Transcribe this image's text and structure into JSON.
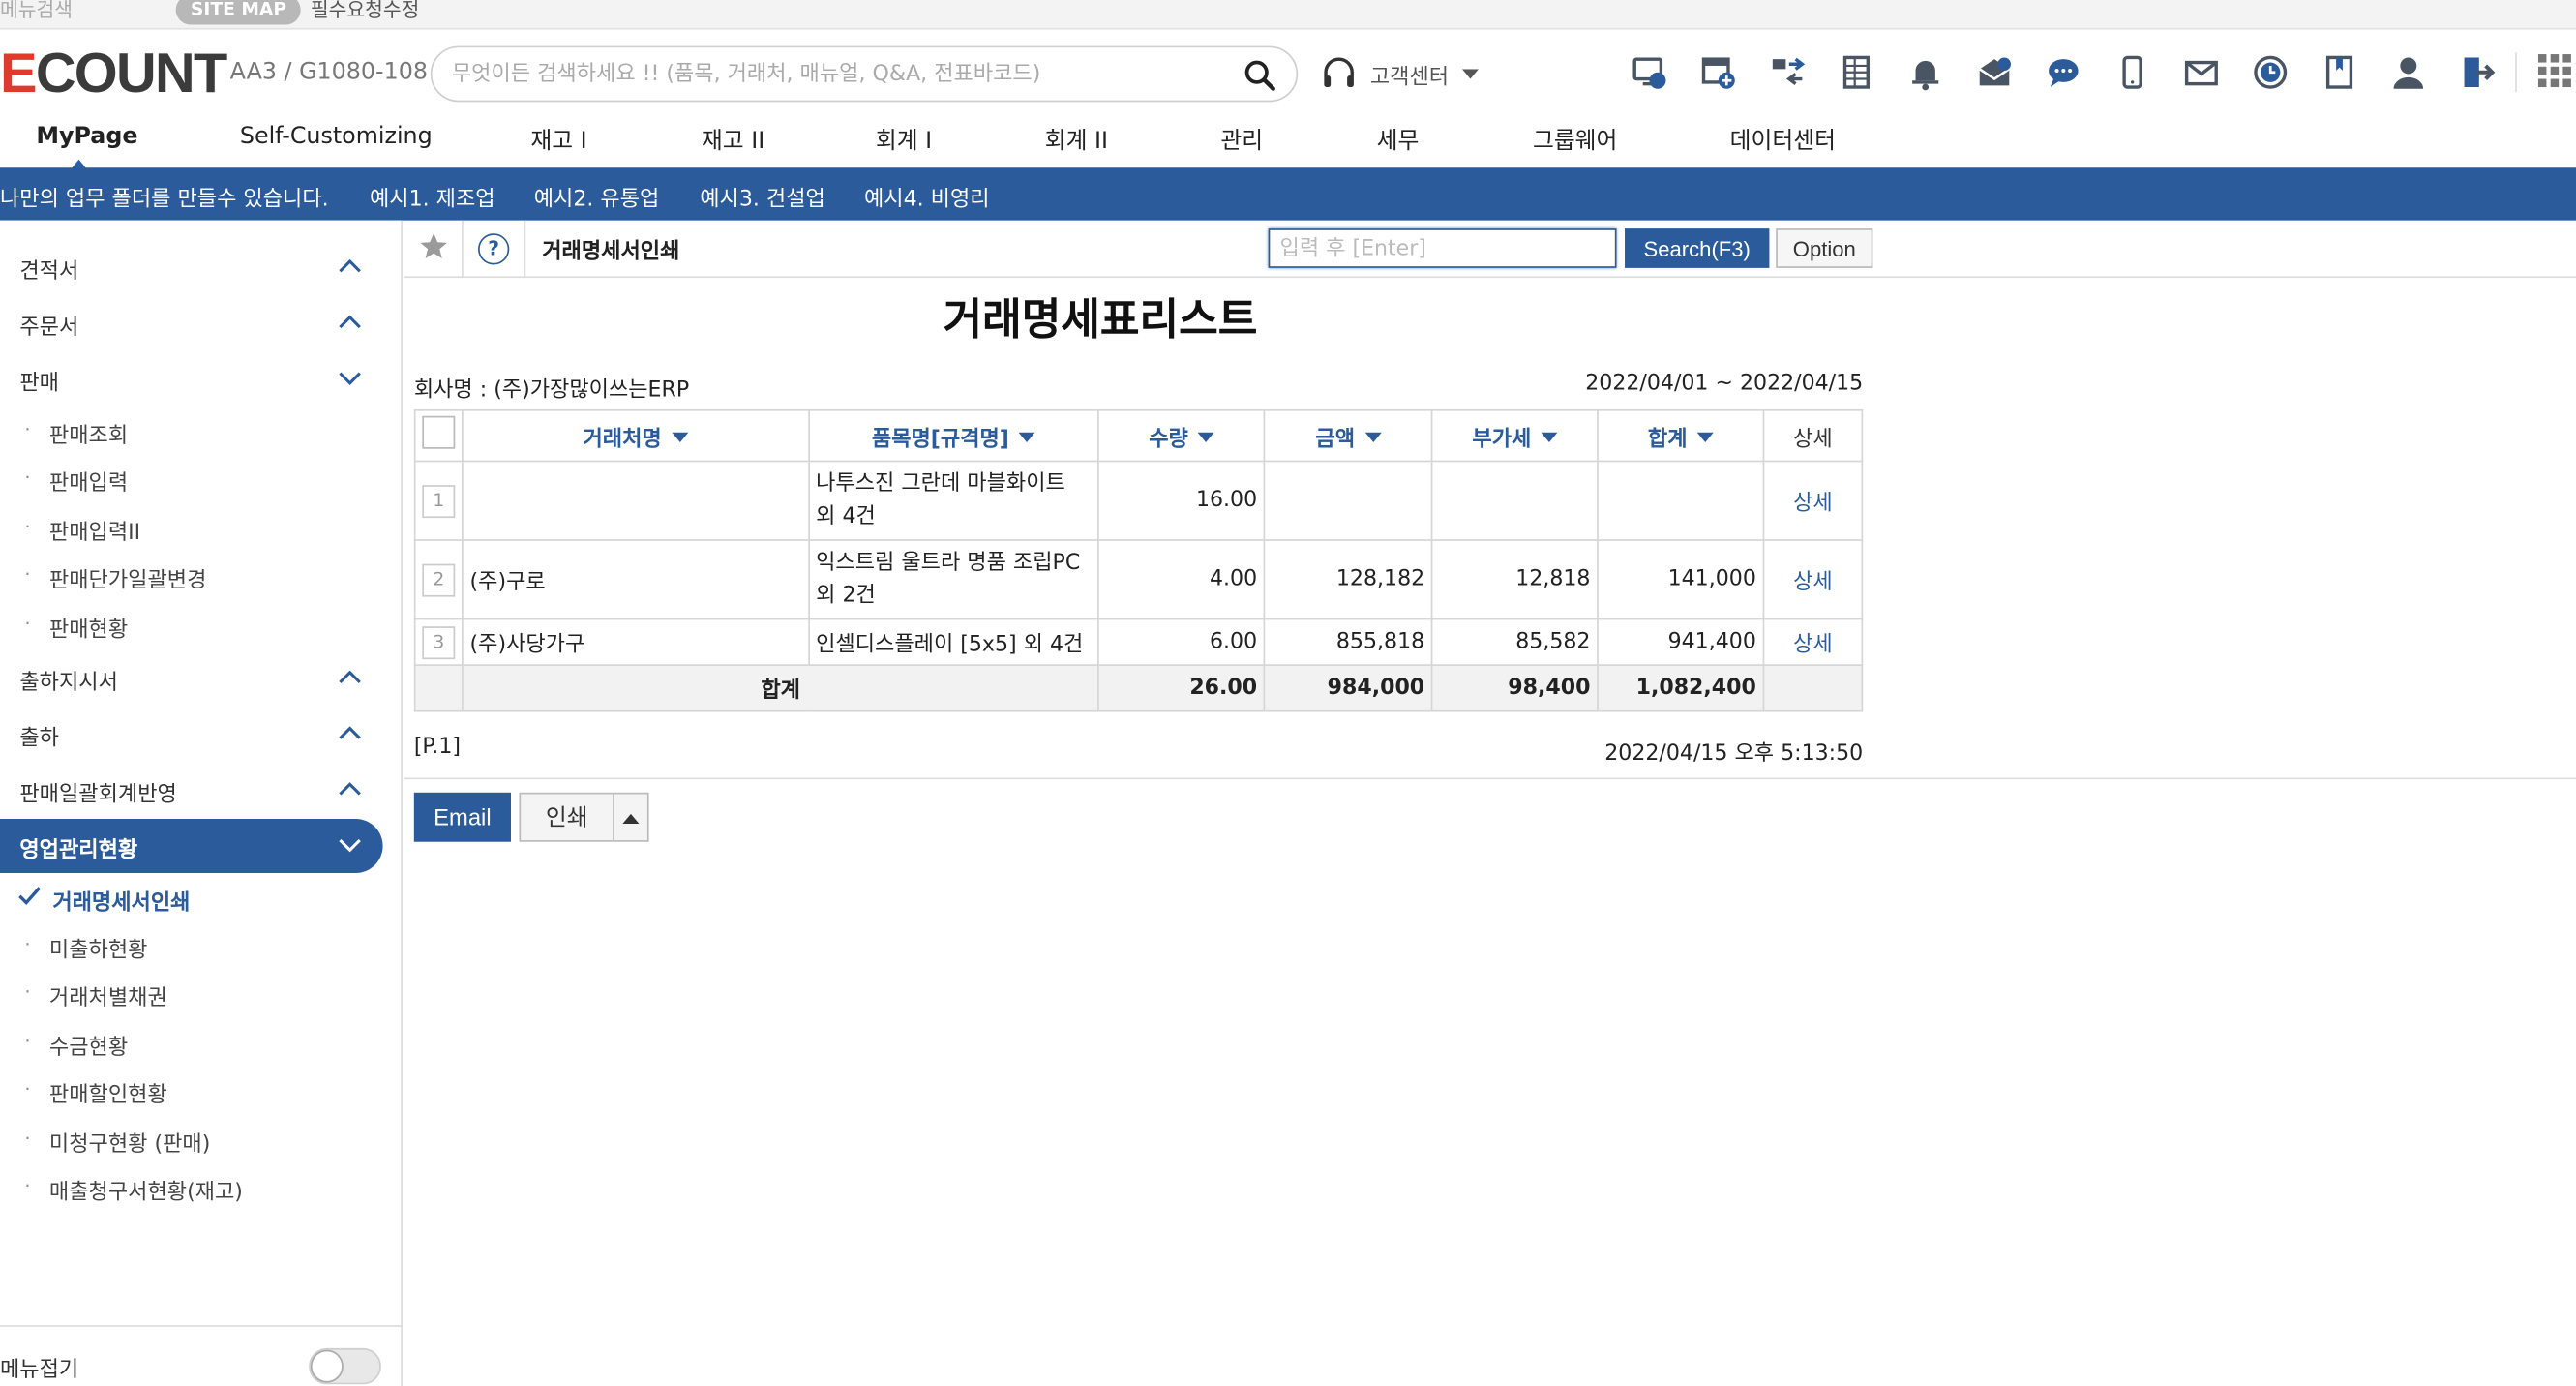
{
  "topstrip": {
    "menu_search": "메뉴검색",
    "sitemap": "SITE MAP",
    "required": "필수요청수정"
  },
  "header": {
    "logo_e": "E",
    "logo_rest": "COUNT",
    "company_code": "AA3 / G1080-108",
    "search_placeholder": "무엇이든 검색하세요 !! (품목, 거래처, 매뉴얼, Q&A, 전표바코드)",
    "support_label": "고객센터",
    "icons": [
      "remote-support-icon",
      "new-window-icon",
      "transfer-icon",
      "spreadsheet-icon",
      "bell-icon",
      "mail-open-icon",
      "chat-icon",
      "mobile-icon",
      "mail-icon",
      "clock-icon",
      "bookmark-icon",
      "user-icon",
      "logout-icon",
      "apps-grid-icon"
    ]
  },
  "mainmenu": {
    "items": [
      "MyPage",
      "Self-Customizing",
      "재고 I",
      "재고 II",
      "회계 I",
      "회계 II",
      "관리",
      "세무",
      "그룹웨어",
      "데이터센터"
    ]
  },
  "bluebar": {
    "items": [
      "나만의 업무 폴더를 만들수 있습니다.",
      "예시1. 제조업",
      "예시2. 유통업",
      "예시3. 건설업",
      "예시4. 비영리"
    ]
  },
  "sidebar": {
    "groups_top": [
      "견적서",
      "주문서",
      "판매"
    ],
    "sales_sub": [
      "판매조회",
      "판매입력",
      "판매입력II",
      "판매단가일괄변경",
      "판매현황"
    ],
    "groups_mid": [
      "출하지시서",
      "출하",
      "판매일괄회계반영"
    ],
    "active_group": "영업관리현황",
    "checked_item": "거래명세서인쇄",
    "active_sub": [
      "미출하현황",
      "거래처별채권",
      "수금현황",
      "판매할인현황",
      "미청구현황 (판매)",
      "매출청구서현황(재고)"
    ],
    "footer_label": "메뉴접기"
  },
  "toolbar": {
    "title": "거래명세서인쇄",
    "quick_placeholder": "입력 후 [Enter]",
    "search_button": "Search(F3)",
    "option_button": "Option"
  },
  "report": {
    "title": "거래명세표리스트",
    "company": "회사명 : (주)가장많이쓰는ERP",
    "period": "2022/04/01 ~ 2022/04/15",
    "columns": [
      "거래처명",
      "품목명[규격명]",
      "수량",
      "금액",
      "부가세",
      "합계",
      "상세"
    ],
    "rows": [
      {
        "no": "1",
        "customer": "",
        "item_line1": "나투스진 그란데 마블화이트",
        "item_line2": "외 4건",
        "qty": "16.00",
        "amount": "",
        "vat": "",
        "total": "",
        "detail": "상세"
      },
      {
        "no": "2",
        "customer": "(주)구로",
        "item_line1": "익스트림 울트라 명품 조립PC",
        "item_line2": "외 2건",
        "qty": "4.00",
        "amount": "128,182",
        "vat": "12,818",
        "total": "141,000",
        "detail": "상세"
      },
      {
        "no": "3",
        "customer": "(주)사당가구",
        "item_line1": "인셀디스플레이 [5x5] 외 4건",
        "item_line2": "",
        "qty": "6.00",
        "amount": "855,818",
        "vat": "85,582",
        "total": "941,400",
        "detail": "상세"
      }
    ],
    "total": {
      "label": "합계",
      "qty": "26.00",
      "amount": "984,000",
      "vat": "98,400",
      "total": "1,082,400"
    },
    "page": "[P.1]",
    "printed_at": "2022/04/15 오후 5:13:50"
  },
  "actions": {
    "email": "Email",
    "print": "인쇄"
  },
  "colors": {
    "primary": "#2b5b9a",
    "logo_red": "#e03a2e"
  }
}
